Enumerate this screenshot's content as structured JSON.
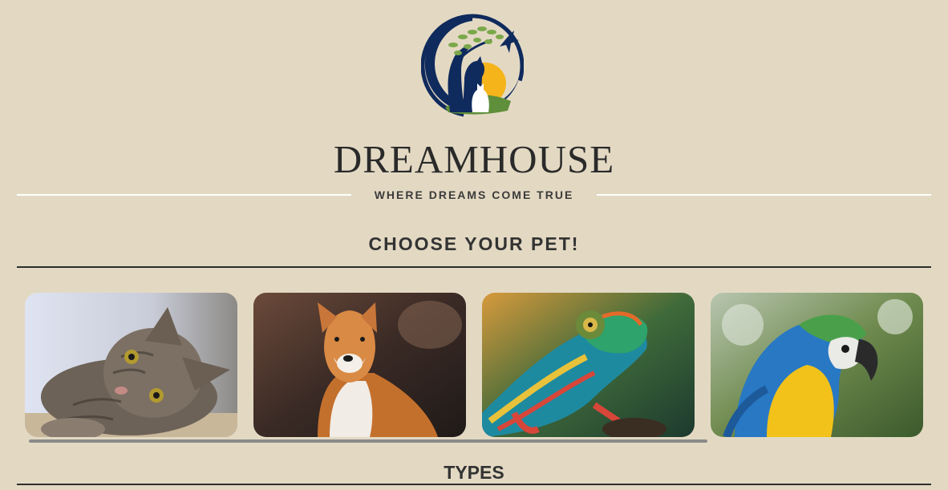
{
  "header": {
    "brand": "DREAMHOUSE",
    "tagline": "WHERE DREAMS COME TRUE",
    "logo_icon": "dreamhouse-logo-icon"
  },
  "colors": {
    "background": "#e3d9c3",
    "text": "#2b2b2b",
    "logo_navy": "#0f2a5c",
    "logo_sun": "#f4b41a",
    "logo_leaf": "#7aa84a"
  },
  "pets_section": {
    "title": "CHOOSE YOUR PET!",
    "cards": [
      {
        "name": "cat",
        "icon": "cat-photo"
      },
      {
        "name": "dog",
        "icon": "shiba-dog-photo"
      },
      {
        "name": "chameleon",
        "icon": "chameleon-photo"
      },
      {
        "name": "parrot",
        "icon": "macaw-parrot-photo"
      }
    ]
  },
  "types_section": {
    "title": "TYPES"
  }
}
